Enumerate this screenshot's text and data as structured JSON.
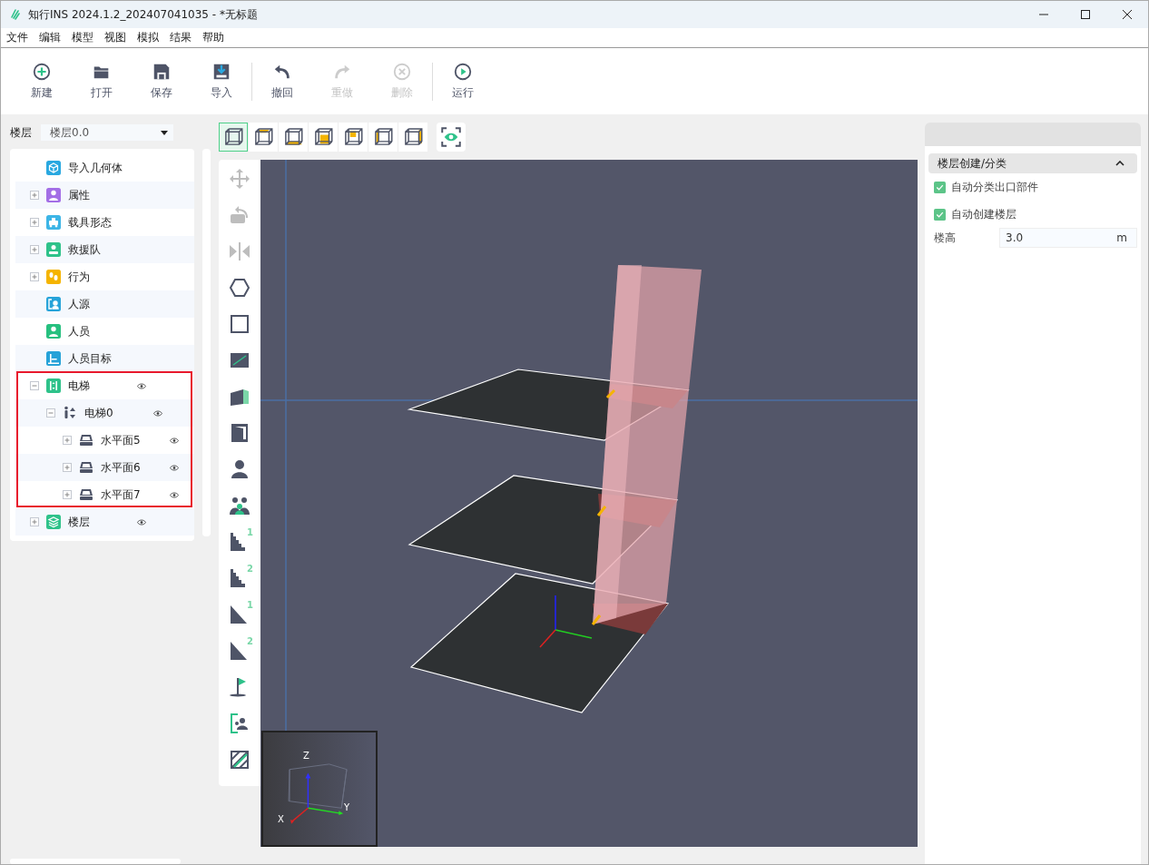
{
  "window": {
    "title": "知行INS 2024.1.2_202407041035 - *无标题"
  },
  "menu": [
    "文件",
    "编辑",
    "模型",
    "视图",
    "模拟",
    "结果",
    "帮助"
  ],
  "toolbar": [
    [
      {
        "label": "新建",
        "disabled": false
      },
      {
        "label": "打开",
        "disabled": false
      },
      {
        "label": "保存",
        "disabled": false
      },
      {
        "label": "导入",
        "disabled": false
      }
    ],
    [
      {
        "label": "撤回",
        "disabled": false
      },
      {
        "label": "重做",
        "disabled": true
      },
      {
        "label": "删除",
        "disabled": true
      }
    ],
    [
      {
        "label": "运行",
        "disabled": false
      }
    ]
  ],
  "floor_select": {
    "label": "楼层",
    "value": "楼层0.0"
  },
  "tree": [
    {
      "label": "导入几何体",
      "color": "#29a8e0"
    },
    {
      "label": "属性",
      "color": "#a36ee6",
      "expanded": false
    },
    {
      "label": "载具形态",
      "color": "#3db5e6",
      "expanded": false
    },
    {
      "label": "救援队",
      "color": "#2ec28a",
      "expanded": false
    },
    {
      "label": "行为",
      "color": "#f5b400",
      "expanded": false
    },
    {
      "label": "人源",
      "color": "#27a3d9"
    },
    {
      "label": "人员",
      "color": "#26c07f"
    },
    {
      "label": "人员目标",
      "color": "#26a2d8"
    },
    {
      "label": "电梯",
      "color": "#2ec28a",
      "expanded": true,
      "visible": true,
      "highlighted": true,
      "children": [
        {
          "label": "电梯0",
          "color": "#4e5467",
          "expanded": true,
          "visible": true,
          "children": [
            {
              "label": "水平面5",
              "color": "#4e5467",
              "expanded": false,
              "visible": true
            },
            {
              "label": "水平面6",
              "color": "#4e5467",
              "expanded": false,
              "visible": true
            },
            {
              "label": "水平面7",
              "color": "#4e5467",
              "expanded": false,
              "visible": true
            }
          ]
        }
      ]
    },
    {
      "label": "楼层",
      "color": "#2ec28a",
      "expanded": false,
      "visible": true
    }
  ],
  "view_buttons": [
    {
      "selected": true
    },
    {
      "selected": false
    },
    {
      "selected": false
    },
    {
      "selected": false
    },
    {
      "selected": false
    },
    {
      "selected": false
    },
    {
      "selected": false
    }
  ],
  "tools": [
    {
      "disabled": true
    },
    {
      "disabled": true
    },
    {
      "disabled": true
    },
    {
      "disabled": false
    },
    {
      "disabled": false
    },
    {
      "disabled": false
    },
    {
      "disabled": false
    },
    {
      "disabled": false
    },
    {
      "disabled": false
    },
    {
      "disabled": false
    },
    {
      "disabled": false,
      "tag": "1"
    },
    {
      "disabled": false,
      "tag": "2"
    },
    {
      "disabled": false,
      "tag": "1"
    },
    {
      "disabled": false,
      "tag": "2"
    },
    {
      "disabled": false
    },
    {
      "disabled": false
    },
    {
      "disabled": false
    }
  ],
  "axis_labels": {
    "z": "Z",
    "x": "X",
    "y": "Y"
  },
  "right_panel": {
    "section": {
      "title": "楼层创建/分类",
      "expanded": true
    },
    "checkboxes": [
      {
        "label": "自动分类出口部件",
        "checked": true
      },
      {
        "label": "自动创建楼层",
        "checked": true
      }
    ],
    "field": {
      "label": "楼高",
      "value": "3.0",
      "unit": "m"
    }
  }
}
